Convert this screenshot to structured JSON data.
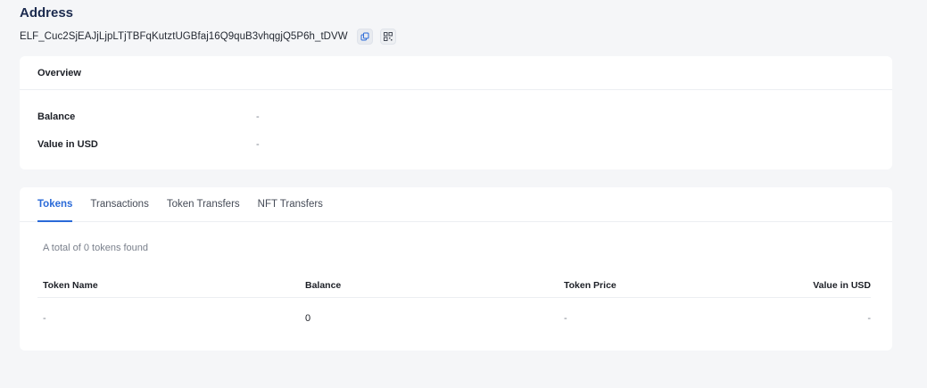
{
  "header": {
    "title": "Address",
    "address": "ELF_Cuc2SjEAJjLjpLTjTBFqKutztUGBfaj16Q9quB3vhqgjQ5P6h_tDVW",
    "copy_icon": "copy-icon",
    "qr_icon": "qr-code-icon"
  },
  "overview": {
    "title": "Overview",
    "rows": [
      {
        "label": "Balance",
        "value": "-"
      },
      {
        "label": "Value in USD",
        "value": "-"
      }
    ]
  },
  "tabs": [
    {
      "label": "Tokens",
      "active": true
    },
    {
      "label": "Transactions",
      "active": false
    },
    {
      "label": "Token Transfers",
      "active": false
    },
    {
      "label": "NFT Transfers",
      "active": false
    }
  ],
  "tokens": {
    "summary": "A total of 0 tokens found",
    "columns": [
      "Token Name",
      "Balance",
      "Token Price",
      "Value in USD"
    ],
    "rows": [
      [
        "-",
        "0",
        "-",
        "-"
      ]
    ]
  },
  "colors": {
    "accent": "#2a6ad8",
    "title": "#1b2a4e",
    "background": "#f5f6f8"
  }
}
